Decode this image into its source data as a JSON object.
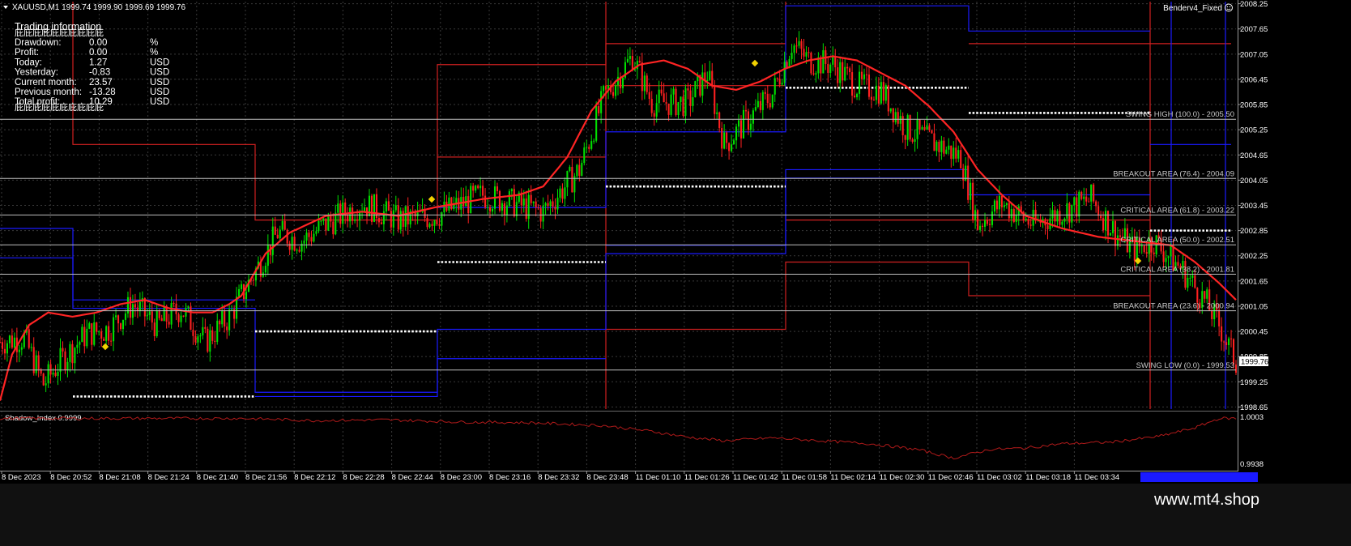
{
  "chart_window": {
    "title": "XAUUSD,M1  1999.74 1999.90 1999.69 1999.76",
    "expert_label": "Benderv4_Fixed",
    "current_price_label": "1999.76",
    "subwindow_title": "Shadow_Index 0.9999",
    "watermark": "www.mt4.shop"
  },
  "info_panel": {
    "title": "Trading information",
    "garble_top": "庇庇庇庇庇庇庇庇庇庇",
    "garble_bottom": "庇庇庇庇庇庇庇庇庇庇",
    "rows": [
      {
        "label": "Drawdown:",
        "value": "0.00",
        "unit": "%"
      },
      {
        "label": "Profit:",
        "value": "0.00",
        "unit": "%"
      },
      {
        "label": "Today:",
        "value": "1.27",
        "unit": "USD"
      },
      {
        "label": "Yesterday:",
        "value": "-0.83",
        "unit": "USD"
      },
      {
        "label": "Current month:",
        "value": "23.57",
        "unit": "USD"
      },
      {
        "label": "Previous month:",
        "value": "-13.28",
        "unit": "USD"
      },
      {
        "label": "Total profit:",
        "value": "10.29",
        "unit": "USD"
      }
    ]
  },
  "fib_levels": [
    {
      "label": "SWING HIGH (100.0) - 2005.50",
      "price": 2005.5
    },
    {
      "label": "BREAKOUT AREA (76.4) - 2004.09",
      "price": 2004.09
    },
    {
      "label": "CRITICAL AREA (61.8) - 2003.22",
      "price": 2003.22
    },
    {
      "label": "CRITICAL AREA (50.0) - 2002.51",
      "price": 2002.51
    },
    {
      "label": "CRITICAL AREA (38.2) - 2001.81",
      "price": 2001.81
    },
    {
      "label": "BREAKOUT AREA (23.6) - 2000.94",
      "price": 2000.94
    },
    {
      "label": "SWING LOW (0.0) - 1999.53",
      "price": 1999.53
    }
  ],
  "colors": {
    "up": "#00e000",
    "down": "#ff2020",
    "ma": "#ff2424",
    "blue": "#1a1aff",
    "red": "#d02020",
    "osc": "#b01a1a",
    "grid": "#3a3a3a"
  },
  "chart_data": {
    "type": "candlestick",
    "price_axis": [
      "2008.25",
      "2007.65",
      "2007.05",
      "2006.45",
      "2005.85",
      "2005.25",
      "2004.65",
      "2004.05",
      "2003.45",
      "2002.85",
      "2002.25",
      "2001.65",
      "2001.05",
      "2000.45",
      "1999.85",
      "1999.25",
      "1998.65"
    ],
    "time_axis": [
      "8 Dec 2023",
      "8 Dec 20:52",
      "8 Dec 21:08",
      "8 Dec 21:24",
      "8 Dec 21:40",
      "8 Dec 21:56",
      "8 Dec 22:12",
      "8 Dec 22:28",
      "8 Dec 22:44",
      "8 Dec 23:00",
      "8 Dec 23:16",
      "8 Dec 23:32",
      "8 Dec 23:48",
      "11 Dec 01:10",
      "11 Dec 01:26",
      "11 Dec 01:42",
      "11 Dec 01:58",
      "11 Dec 02:14",
      "11 Dec 02:30",
      "11 Dec 02:46",
      "11 Dec 03:02",
      "11 Dec 03:18",
      "11 Dec 03:34"
    ],
    "ylim": [
      1998.6,
      2008.3
    ],
    "osc_axis": [
      "1.0003",
      "0.9938"
    ],
    "osc_ylim": [
      0.9932,
      1.0006
    ],
    "ma_path": [
      [
        0,
        1998.8
      ],
      [
        5,
        1999.9
      ],
      [
        12,
        2000.6
      ],
      [
        20,
        2000.9
      ],
      [
        30,
        2000.8
      ],
      [
        40,
        2000.9
      ],
      [
        50,
        2001.1
      ],
      [
        60,
        2001.2
      ],
      [
        70,
        2001.0
      ],
      [
        80,
        2000.9
      ],
      [
        88,
        2000.9
      ],
      [
        95,
        2001.1
      ],
      [
        100,
        2001.3
      ],
      [
        110,
        2002.3
      ],
      [
        120,
        2002.8
      ],
      [
        135,
        2003.2
      ],
      [
        150,
        2003.3
      ],
      [
        165,
        2003.2
      ],
      [
        180,
        2003.4
      ],
      [
        200,
        2003.6
      ],
      [
        215,
        2003.7
      ],
      [
        225,
        2003.9
      ],
      [
        235,
        2004.6
      ],
      [
        245,
        2005.7
      ],
      [
        255,
        2006.4
      ],
      [
        265,
        2006.8
      ],
      [
        275,
        2006.9
      ],
      [
        285,
        2006.7
      ],
      [
        295,
        2006.3
      ],
      [
        305,
        2006.2
      ],
      [
        315,
        2006.4
      ],
      [
        325,
        2006.7
      ],
      [
        335,
        2006.9
      ],
      [
        345,
        2007.0
      ],
      [
        355,
        2006.9
      ],
      [
        365,
        2006.6
      ],
      [
        375,
        2006.3
      ],
      [
        385,
        2005.8
      ],
      [
        395,
        2005.2
      ],
      [
        405,
        2004.3
      ],
      [
        415,
        2003.7
      ],
      [
        425,
        2003.2
      ],
      [
        440,
        2002.9
      ],
      [
        455,
        2002.7
      ],
      [
        470,
        2002.6
      ],
      [
        485,
        2002.5
      ],
      [
        495,
        2002.1
      ],
      [
        505,
        2001.6
      ],
      [
        512,
        2001.2
      ]
    ],
    "candle_anchors": [
      [
        0,
        2000.2
      ],
      [
        10,
        2000.3
      ],
      [
        18,
        1999.2
      ],
      [
        26,
        1999.8
      ],
      [
        36,
        2000.4
      ],
      [
        45,
        2000.5
      ],
      [
        55,
        2001.1
      ],
      [
        65,
        2000.6
      ],
      [
        75,
        2001.0
      ],
      [
        85,
        2000.2
      ],
      [
        95,
        2000.8
      ],
      [
        105,
        2001.8
      ],
      [
        115,
        2002.8
      ],
      [
        125,
        2002.6
      ],
      [
        135,
        2003.0
      ],
      [
        150,
        2003.5
      ],
      [
        165,
        2003.1
      ],
      [
        180,
        2003.2
      ],
      [
        200,
        2003.7
      ],
      [
        225,
        2003.3
      ],
      [
        240,
        2004.3
      ],
      [
        250,
        2006.0
      ],
      [
        262,
        2007.0
      ],
      [
        270,
        2005.9
      ],
      [
        285,
        2005.9
      ],
      [
        293,
        2006.6
      ],
      [
        300,
        2004.9
      ],
      [
        310,
        2005.5
      ],
      [
        320,
        2006.1
      ],
      [
        328,
        2007.3
      ],
      [
        335,
        2006.9
      ],
      [
        345,
        2006.8
      ],
      [
        355,
        2006.3
      ],
      [
        365,
        2006.2
      ],
      [
        375,
        2005.3
      ],
      [
        385,
        2005.0
      ],
      [
        398,
        2004.6
      ],
      [
        405,
        2003.0
      ],
      [
        415,
        2003.5
      ],
      [
        428,
        2003.0
      ],
      [
        440,
        2003.3
      ],
      [
        452,
        2003.6
      ],
      [
        462,
        2002.8
      ],
      [
        470,
        2002.4
      ],
      [
        478,
        2002.6
      ],
      [
        490,
        2001.9
      ],
      [
        500,
        2001.1
      ],
      [
        505,
        2000.6
      ],
      [
        512,
        1999.7
      ]
    ],
    "oscillator": [
      [
        0,
        1.0001
      ],
      [
        40,
        1.0001
      ],
      [
        80,
        1.0001
      ],
      [
        100,
        1.0001
      ],
      [
        130,
        0.9998
      ],
      [
        160,
        0.9999
      ],
      [
        190,
        0.9996
      ],
      [
        220,
        0.9995
      ],
      [
        250,
        0.9991
      ],
      [
        270,
        0.9983
      ],
      [
        285,
        0.9975
      ],
      [
        300,
        0.997
      ],
      [
        320,
        0.9974
      ],
      [
        340,
        0.997
      ],
      [
        360,
        0.9966
      ],
      [
        380,
        0.9958
      ],
      [
        395,
        0.9946
      ],
      [
        410,
        0.9958
      ],
      [
        425,
        0.996
      ],
      [
        440,
        0.9966
      ],
      [
        460,
        0.9968
      ],
      [
        480,
        0.9976
      ],
      [
        495,
        0.9988
      ],
      [
        505,
        1.0001
      ],
      [
        512,
        1.0001
      ]
    ]
  }
}
